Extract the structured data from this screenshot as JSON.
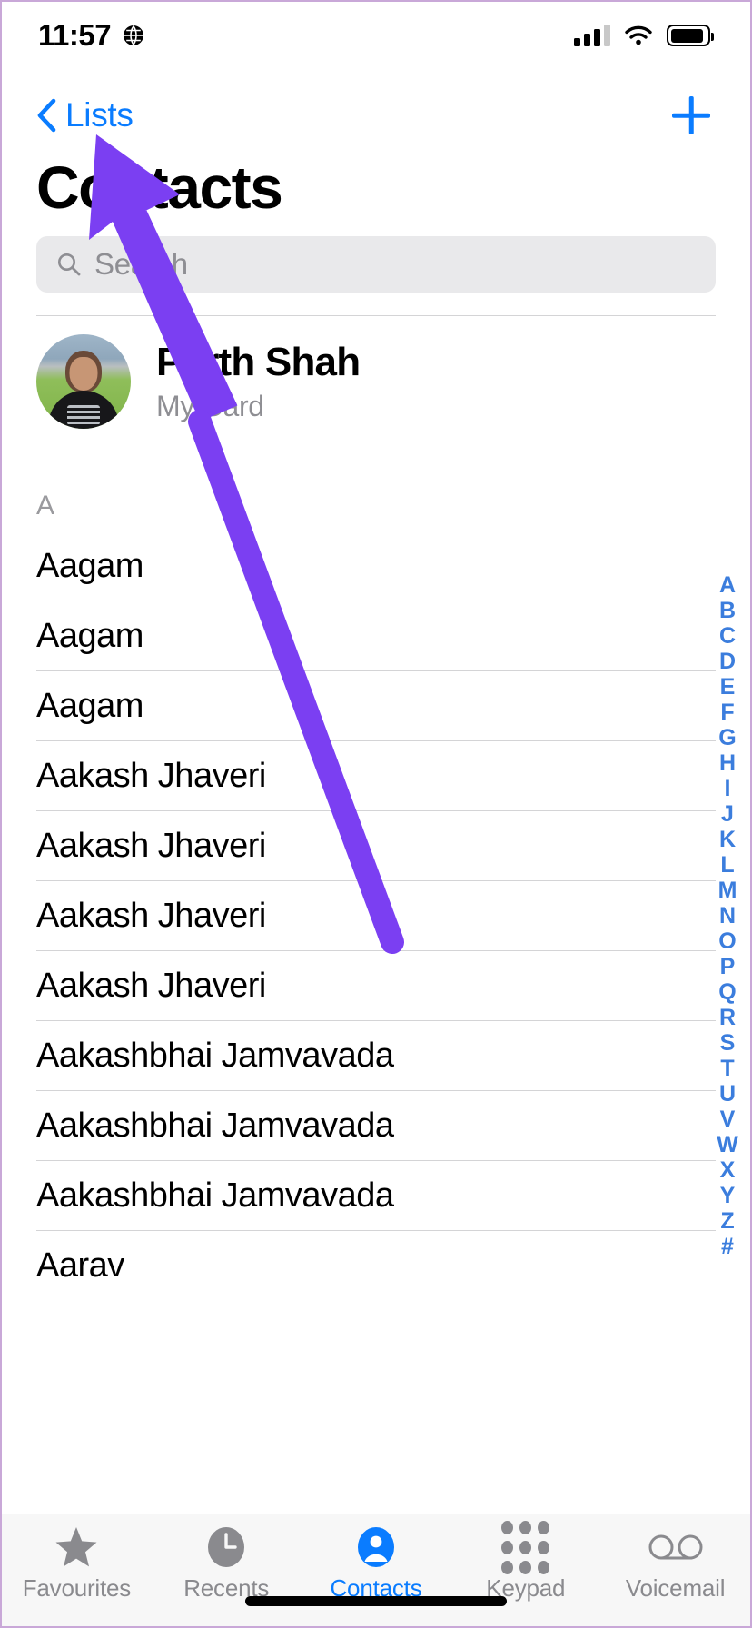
{
  "status_bar": {
    "time": "11:57",
    "location_icon": "location-services-icon",
    "cellular_icon": "cellular-signal-icon",
    "wifi_icon": "wifi-icon",
    "battery_icon": "battery-icon"
  },
  "nav_bar": {
    "back_label": "Lists",
    "back_icon": "chevron-left-icon",
    "add_icon": "plus-icon"
  },
  "page_title": "Contacts",
  "search": {
    "placeholder": "Search",
    "value": "",
    "icon": "search-icon"
  },
  "my_card": {
    "name": "Parth Shah",
    "subtitle": "My Card",
    "avatar": "contact-photo-avatar"
  },
  "sections": [
    {
      "letter": "A",
      "contacts": [
        "Aagam",
        "Aagam",
        "Aagam",
        "Aakash Jhaveri",
        "Aakash Jhaveri",
        "Aakash Jhaveri",
        "Aakash Jhaveri",
        "Aakashbhai Jamvavada",
        "Aakashbhai Jamvavada",
        "Aakashbhai Jamvavada",
        "Aarav"
      ]
    }
  ],
  "index_bar": [
    "A",
    "B",
    "C",
    "D",
    "E",
    "F",
    "G",
    "H",
    "I",
    "J",
    "K",
    "L",
    "M",
    "N",
    "O",
    "P",
    "Q",
    "R",
    "S",
    "T",
    "U",
    "V",
    "W",
    "X",
    "Y",
    "Z",
    "#"
  ],
  "tab_bar": {
    "items": [
      {
        "label": "Favourites",
        "icon": "star-icon",
        "active": false
      },
      {
        "label": "Recents",
        "icon": "clock-icon",
        "active": false
      },
      {
        "label": "Contacts",
        "icon": "person-circle-icon",
        "active": true
      },
      {
        "label": "Keypad",
        "icon": "keypad-icon",
        "active": false
      },
      {
        "label": "Voicemail",
        "icon": "voicemail-icon",
        "active": false
      }
    ]
  },
  "annotation": {
    "type": "arrow",
    "color": "#7b3ff2",
    "points_to": "Lists"
  },
  "colors": {
    "accent": "#0a7cff",
    "index": "#3b7ddd",
    "secondary_text": "#8e8e93",
    "separator": "#d4d4d6",
    "search_bg": "#e9e9eb",
    "tabbar_bg": "#f7f7f7",
    "annotation": "#7b3ff2"
  }
}
